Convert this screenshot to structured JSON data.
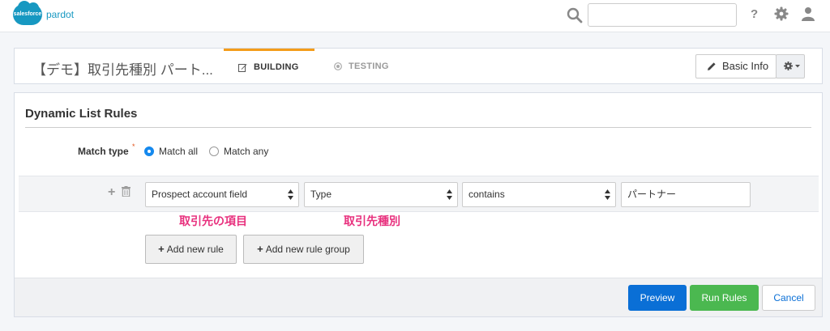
{
  "brand": {
    "cloud_text": "salesforce",
    "product": "pardot"
  },
  "topbar": {
    "search_placeholder": "",
    "help_glyph": "?"
  },
  "header": {
    "title": "【デモ】取引先種別 パート...",
    "tabs": [
      {
        "label": "BUILDING",
        "active": true,
        "icon": "edit-icon"
      },
      {
        "label": "TESTING",
        "active": false,
        "icon": "target-icon"
      }
    ],
    "basic_info_label": "Basic Info"
  },
  "rules": {
    "title": "Dynamic List Rules",
    "match_type_label": "Match type",
    "required_mark": "*",
    "match_options": [
      {
        "label": "Match all",
        "selected": true
      },
      {
        "label": "Match any",
        "selected": false
      }
    ],
    "row": {
      "field_category": "Prospect account field",
      "field": "Type",
      "operator": "contains",
      "value": "パートナー"
    },
    "annotations": [
      "取引先の項目",
      "取引先種別"
    ],
    "add_rule_label": "Add new rule",
    "add_group_label": "Add new rule group"
  },
  "footer": {
    "preview_label": "Preview",
    "run_label": "Run Rules",
    "cancel_label": "Cancel"
  },
  "colors": {
    "accent_tab": "#f49c1a",
    "primary": "#0a6fd6",
    "success": "#4bb850",
    "annotation": "#e8317e",
    "brand": "#1798c1"
  }
}
